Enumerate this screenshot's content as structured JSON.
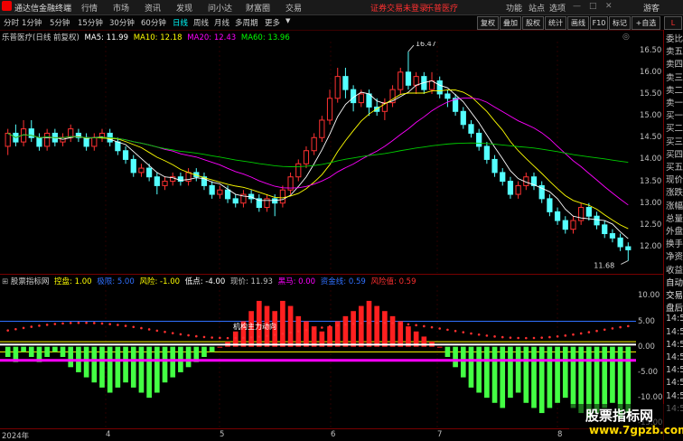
{
  "titlebar": {
    "app_name": "通达信金融终端",
    "menu": [
      "行情",
      "市场",
      "资讯",
      "发现",
      "问小达",
      "财富圈",
      "交易"
    ],
    "status": "证券交易未登录",
    "stock_name": "乐普医疗",
    "right_menu": [
      "功能",
      "站点",
      "选项"
    ],
    "user": "游客"
  },
  "toolbar": {
    "periods": [
      "分时",
      "1分钟",
      "5分钟",
      "15分钟",
      "30分钟",
      "60分钟",
      "日线",
      "周线",
      "月线",
      "多周期",
      "更多"
    ],
    "active_period": "日线",
    "buttons": [
      "复权",
      "叠加",
      "股权",
      "统计",
      "画线",
      "F10",
      "标记",
      "+自选"
    ]
  },
  "main_chart": {
    "header_name": "乐普医疗(日线 前复权)",
    "ma": [
      {
        "label": "MA5: 11.99",
        "color": "#ffffff"
      },
      {
        "label": "MA10: 12.18",
        "color": "#ffff00"
      },
      {
        "label": "MA20: 12.43",
        "color": "#ff00ff"
      },
      {
        "label": "MA60: 13.96",
        "color": "#00ff00"
      }
    ],
    "price_ticks": [
      "16.50",
      "16.00",
      "15.50",
      "15.00",
      "14.50",
      "14.00",
      "13.50",
      "13.00",
      "12.50",
      "12.00"
    ],
    "high_label": "16.47",
    "low_label": "11.68"
  },
  "sub_chart": {
    "name": "股票指标网",
    "items": [
      {
        "label": "控盘: 1.00",
        "color": "#ffff00"
      },
      {
        "label": "极限: 5.00",
        "color": "#3070ff"
      },
      {
        "label": "风险: -1.00",
        "color": "#ffff00"
      },
      {
        "label": "低点: -4.00",
        "color": "#ffffff"
      },
      {
        "label": "现价: 11.93",
        "color": "#c0c0c0"
      },
      {
        "label": "黑马: 0.00",
        "color": "#ff00ff"
      },
      {
        "label": "资金线: 0.59",
        "color": "#3070ff"
      },
      {
        "label": "风险值: 0.59",
        "color": "#ff3030"
      }
    ],
    "ticks": [
      "10.00",
      "5.00",
      "0.00",
      "-5.00",
      "-10.00",
      "-15.00"
    ],
    "annotation": "机构主力动向"
  },
  "time_axis": {
    "year": "2024年",
    "months": [
      "4",
      "5",
      "6",
      "7",
      "8"
    ]
  },
  "right_panel": {
    "items": [
      "委比",
      "卖五",
      "卖四",
      "卖三",
      "卖二",
      "卖一",
      "买一",
      "买二",
      "买三",
      "买四",
      "买五",
      "现价",
      "涨跌",
      "涨幅",
      "总量",
      "外盘",
      "换手",
      "净资",
      "收益",
      "自动",
      "交易",
      "盘后",
      "14:50",
      "14:50",
      "14:50",
      "14:50",
      "14:50",
      "14:50",
      "14:50",
      "14:50"
    ]
  },
  "watermark": {
    "line1": "股票指标网",
    "line2": "www.7gpzb.com"
  },
  "chart_data": {
    "type": "candlestick",
    "title": "乐普医疗(日线 前复权)",
    "ylim": [
      11.4,
      16.7
    ],
    "candles": [
      [
        14.3,
        14.6,
        14.7,
        14.1
      ],
      [
        14.6,
        14.4,
        14.8,
        14.3
      ],
      [
        14.4,
        14.7,
        14.9,
        14.3
      ],
      [
        14.7,
        14.5,
        14.9,
        14.4
      ],
      [
        14.5,
        14.3,
        14.6,
        14.2
      ],
      [
        14.3,
        14.6,
        14.7,
        14.2
      ],
      [
        14.6,
        14.4,
        14.7,
        14.3
      ],
      [
        14.4,
        14.5,
        14.6,
        14.3
      ],
      [
        14.5,
        14.7,
        14.8,
        14.4
      ],
      [
        14.6,
        14.5,
        14.7,
        14.4
      ],
      [
        14.5,
        14.3,
        14.6,
        14.2
      ],
      [
        14.3,
        14.5,
        14.6,
        14.2
      ],
      [
        14.5,
        14.6,
        14.7,
        14.4
      ],
      [
        14.6,
        14.4,
        14.7,
        14.3
      ],
      [
        14.4,
        14.2,
        14.5,
        14.1
      ],
      [
        14.2,
        14.0,
        14.3,
        13.9
      ],
      [
        14.0,
        13.7,
        14.1,
        13.6
      ],
      [
        13.7,
        13.8,
        13.9,
        13.6
      ],
      [
        13.8,
        13.6,
        13.9,
        13.5
      ],
      [
        13.6,
        13.4,
        13.7,
        13.2
      ],
      [
        13.4,
        13.5,
        13.6,
        13.3
      ],
      [
        13.5,
        13.6,
        13.7,
        13.4
      ],
      [
        13.6,
        13.5,
        13.7,
        13.4
      ],
      [
        13.5,
        13.7,
        13.8,
        13.4
      ],
      [
        13.7,
        13.6,
        13.8,
        13.5
      ],
      [
        13.6,
        13.4,
        13.7,
        13.3
      ],
      [
        13.4,
        13.2,
        13.5,
        13.1
      ],
      [
        13.2,
        13.3,
        13.4,
        13.1
      ],
      [
        13.3,
        13.1,
        13.4,
        13.0
      ],
      [
        13.1,
        13.0,
        13.2,
        12.9
      ],
      [
        13.0,
        13.2,
        13.3,
        12.9
      ],
      [
        13.2,
        13.1,
        13.3,
        13.0
      ],
      [
        13.1,
        12.9,
        13.2,
        12.8
      ],
      [
        12.9,
        13.1,
        13.2,
        12.8
      ],
      [
        13.1,
        13.0,
        13.2,
        12.7
      ],
      [
        13.0,
        13.3,
        13.4,
        12.9
      ],
      [
        13.3,
        13.6,
        13.7,
        13.2
      ],
      [
        13.6,
        13.9,
        14.0,
        13.5
      ],
      [
        13.9,
        14.2,
        14.3,
        13.8
      ],
      [
        14.2,
        14.5,
        14.6,
        14.1
      ],
      [
        14.5,
        14.9,
        15.0,
        14.4
      ],
      [
        14.9,
        15.4,
        15.6,
        14.8
      ],
      [
        15.4,
        15.9,
        16.1,
        15.3
      ],
      [
        15.9,
        15.6,
        16.1,
        15.4
      ],
      [
        15.6,
        15.3,
        15.7,
        15.1
      ],
      [
        15.3,
        15.5,
        15.6,
        15.2
      ],
      [
        15.5,
        15.2,
        15.6,
        15.0
      ],
      [
        15.2,
        15.1,
        15.4,
        15.0
      ],
      [
        15.1,
        15.3,
        15.4,
        14.9
      ],
      [
        15.3,
        15.6,
        15.7,
        15.2
      ],
      [
        15.6,
        16.0,
        16.1,
        15.5
      ],
      [
        16.0,
        15.7,
        16.47,
        15.6
      ],
      [
        15.7,
        15.9,
        16.0,
        15.5
      ],
      [
        15.9,
        15.6,
        16.0,
        15.5
      ],
      [
        15.6,
        15.8,
        16.0,
        15.5
      ],
      [
        15.8,
        15.5,
        15.9,
        15.4
      ],
      [
        15.5,
        15.4,
        15.6,
        15.2
      ],
      [
        15.4,
        15.1,
        15.5,
        15.0
      ],
      [
        15.1,
        14.8,
        15.2,
        14.7
      ],
      [
        14.8,
        14.6,
        14.9,
        14.5
      ],
      [
        14.6,
        14.3,
        14.7,
        14.2
      ],
      [
        14.3,
        14.0,
        14.4,
        13.9
      ],
      [
        14.0,
        13.7,
        14.1,
        13.6
      ],
      [
        13.7,
        13.5,
        13.8,
        13.4
      ],
      [
        13.5,
        13.2,
        13.6,
        13.1
      ],
      [
        13.2,
        13.4,
        13.5,
        13.1
      ],
      [
        13.4,
        13.6,
        13.7,
        13.3
      ],
      [
        13.6,
        13.4,
        13.7,
        13.3
      ],
      [
        13.4,
        13.1,
        13.5,
        13.0
      ],
      [
        13.1,
        12.8,
        13.2,
        12.7
      ],
      [
        12.8,
        12.6,
        12.9,
        12.5
      ],
      [
        12.6,
        12.4,
        12.7,
        12.3
      ],
      [
        12.4,
        12.6,
        12.7,
        12.3
      ],
      [
        12.6,
        12.9,
        13.0,
        12.5
      ],
      [
        12.9,
        12.7,
        13.0,
        12.6
      ],
      [
        12.7,
        12.5,
        12.8,
        12.4
      ],
      [
        12.5,
        12.3,
        12.6,
        12.2
      ],
      [
        12.3,
        12.2,
        12.4,
        12.1
      ],
      [
        12.2,
        12.0,
        12.3,
        11.9
      ],
      [
        12.0,
        11.93,
        12.1,
        11.68
      ]
    ],
    "oscillator": [
      -2,
      -3,
      -1,
      -2,
      -3,
      -2,
      -1,
      -2,
      -4,
      -5,
      -6,
      -7,
      -8,
      -9,
      -8,
      -7,
      -8,
      -9,
      -10,
      -9,
      -7,
      -6,
      -5,
      -4,
      -3,
      -2,
      -1,
      0,
      1,
      3,
      5,
      7,
      9,
      8,
      7,
      9,
      8,
      6,
      5,
      4,
      3,
      4,
      5,
      6,
      7,
      8,
      9,
      8,
      7,
      6,
      5,
      4,
      3,
      2,
      1,
      0,
      -2,
      -4,
      -6,
      -8,
      -9,
      -10,
      -11,
      -12,
      -10,
      -9,
      -11,
      -12,
      -13,
      -12,
      -11,
      -10,
      -12,
      -13,
      -14,
      -13,
      -12,
      -11,
      -14,
      -13
    ]
  }
}
